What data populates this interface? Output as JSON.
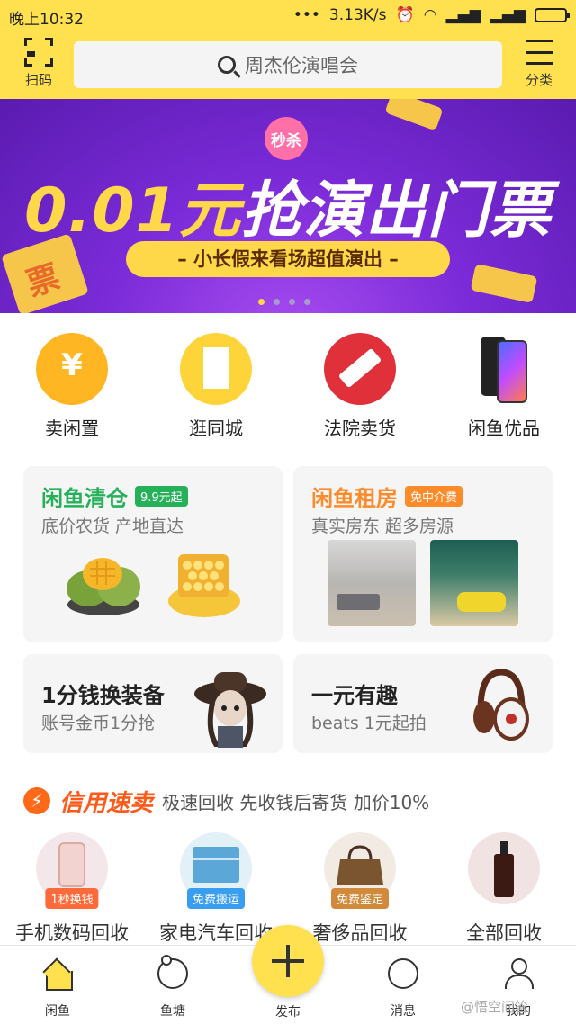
{
  "status": {
    "time": "晚上10:32",
    "dots": "•••",
    "speed": "3.13K/s"
  },
  "header": {
    "scan_label": "扫码",
    "search_placeholder": "周杰伦演唱会",
    "category_label": "分类"
  },
  "banner": {
    "badge": "秒杀",
    "title_price": "0.01元",
    "title_rest": "抢演出门票",
    "subtitle": "– 小长假来看场超值演出 –",
    "ticket_char": "票",
    "dots": 4,
    "active_dot": 0
  },
  "quick": [
    {
      "label": "卖闲置",
      "icon": "yen-icon"
    },
    {
      "label": "逛同城",
      "icon": "city-icon"
    },
    {
      "label": "法院卖货",
      "icon": "hammer-icon"
    },
    {
      "label": "闲鱼优品",
      "icon": "phone-icon"
    }
  ],
  "cards": {
    "clearance": {
      "title": "闲鱼清仓",
      "tag": "9.9元起",
      "sub": "底价农货 产地直达"
    },
    "rent": {
      "title": "闲鱼租房",
      "tag": "免中介费",
      "sub": "真实房东 超多房源"
    },
    "gear": {
      "title": "1分钱换装备",
      "sub": "账号金币1分抢"
    },
    "fun": {
      "title": "一元有趣",
      "sub": "beats 1元起拍"
    }
  },
  "credit": {
    "brand": "信用速卖",
    "desc": "极速回收 先收钱后寄货 加价10%",
    "items": [
      {
        "label": "手机数码回收",
        "pill": "1秒换钱"
      },
      {
        "label": "家电汽车回收",
        "pill": "免费搬运"
      },
      {
        "label": "奢侈品回收",
        "pill": "免费鉴定"
      },
      {
        "label": "全部回收",
        "pill": ""
      }
    ]
  },
  "nav": {
    "items": [
      "闲鱼",
      "鱼塘",
      "发布",
      "消息",
      "我的"
    ],
    "active": "闲鱼"
  },
  "watermark": "@悟空问答",
  "colors": {
    "brand_yellow": "#ffe14f",
    "green": "#26b05a",
    "orange": "#ff8a2a",
    "credit_red": "#ff5a1a"
  }
}
